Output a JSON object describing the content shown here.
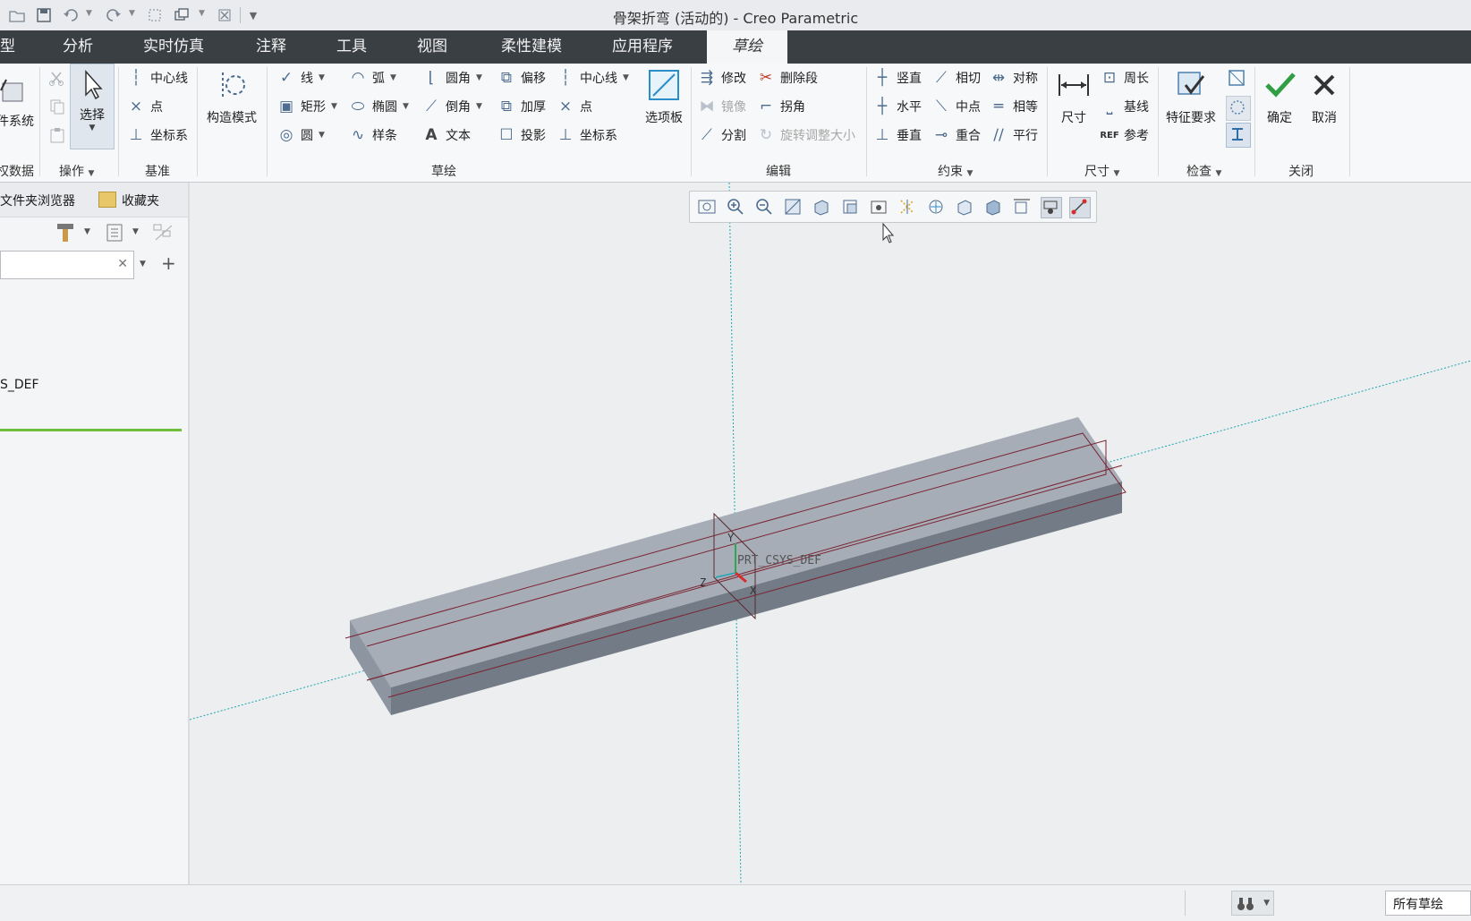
{
  "window": {
    "title": "骨架折弯 (活动的) - Creo Parametric"
  },
  "quick_access": [
    "open-icon",
    "save-icon",
    "undo-icon",
    "redo-icon",
    "regenerate-icon",
    "windows-icon",
    "close-window-icon",
    "customize-icon"
  ],
  "tabs": [
    "型",
    "分析",
    "实时仿真",
    "注释",
    "工具",
    "视图",
    "柔性建模",
    "应用程序",
    "草绘"
  ],
  "active_tab": "草绘",
  "ribbon": {
    "partial_left": {
      "csys_label": "件系统",
      "group_label": "权数据"
    },
    "operations": {
      "select_label": "选择",
      "group_label": "操作"
    },
    "datum": {
      "centerline": "中心线",
      "point": "点",
      "csys": "坐标系",
      "group_label": "基准"
    },
    "sketch": {
      "construction_mode": "构造模式",
      "line": "线",
      "rectangle": "矩形",
      "circle": "圆",
      "arc": "弧",
      "ellipse": "椭圆",
      "spline": "样条",
      "fillet": "圆角",
      "chamfer": "倒角",
      "text": "文本",
      "offset": "偏移",
      "thicken": "加厚",
      "project": "投影",
      "centerline": "中心线",
      "point": "点",
      "csys": "坐标系",
      "palette": "选项板",
      "group_label": "草绘"
    },
    "edit": {
      "modify": "修改",
      "delete_segment": "删除段",
      "mirror": "镜像",
      "corner": "拐角",
      "divide": "分割",
      "rotate_resize": "旋转调整大小",
      "group_label": "编辑"
    },
    "constrain": {
      "vertical": "竖直",
      "tangent": "相切",
      "symmetric": "对称",
      "horizontal": "水平",
      "midpoint": "中点",
      "equal": "相等",
      "perpendicular": "垂直",
      "coincident": "重合",
      "parallel": "平行",
      "group_label": "约束"
    },
    "dimension": {
      "dimension": "尺寸",
      "perimeter": "周长",
      "baseline": "基线",
      "reference": "参考",
      "group_label": "尺寸"
    },
    "inspect": {
      "feature_requirements": "特征要求",
      "group_label": "检查"
    },
    "close": {
      "ok": "确定",
      "cancel": "取消",
      "group_label": "关闭"
    }
  },
  "left_panel": {
    "tabs": [
      "文件夹浏览器",
      "收藏夹"
    ],
    "search_value": "",
    "tree_item": "S_DEF"
  },
  "viewport": {
    "csys_label": "PRT_CSYS_DEF",
    "axes": [
      "Y",
      "Z",
      "X"
    ]
  },
  "status_bar": {
    "filter": "所有草绘"
  },
  "colors": {
    "tabbar": "#3a3f44",
    "part_top": "#a6adb7",
    "part_front": "#737b86",
    "sketch_line": "#7a2330",
    "datum_axis": "#1fa5b5"
  }
}
